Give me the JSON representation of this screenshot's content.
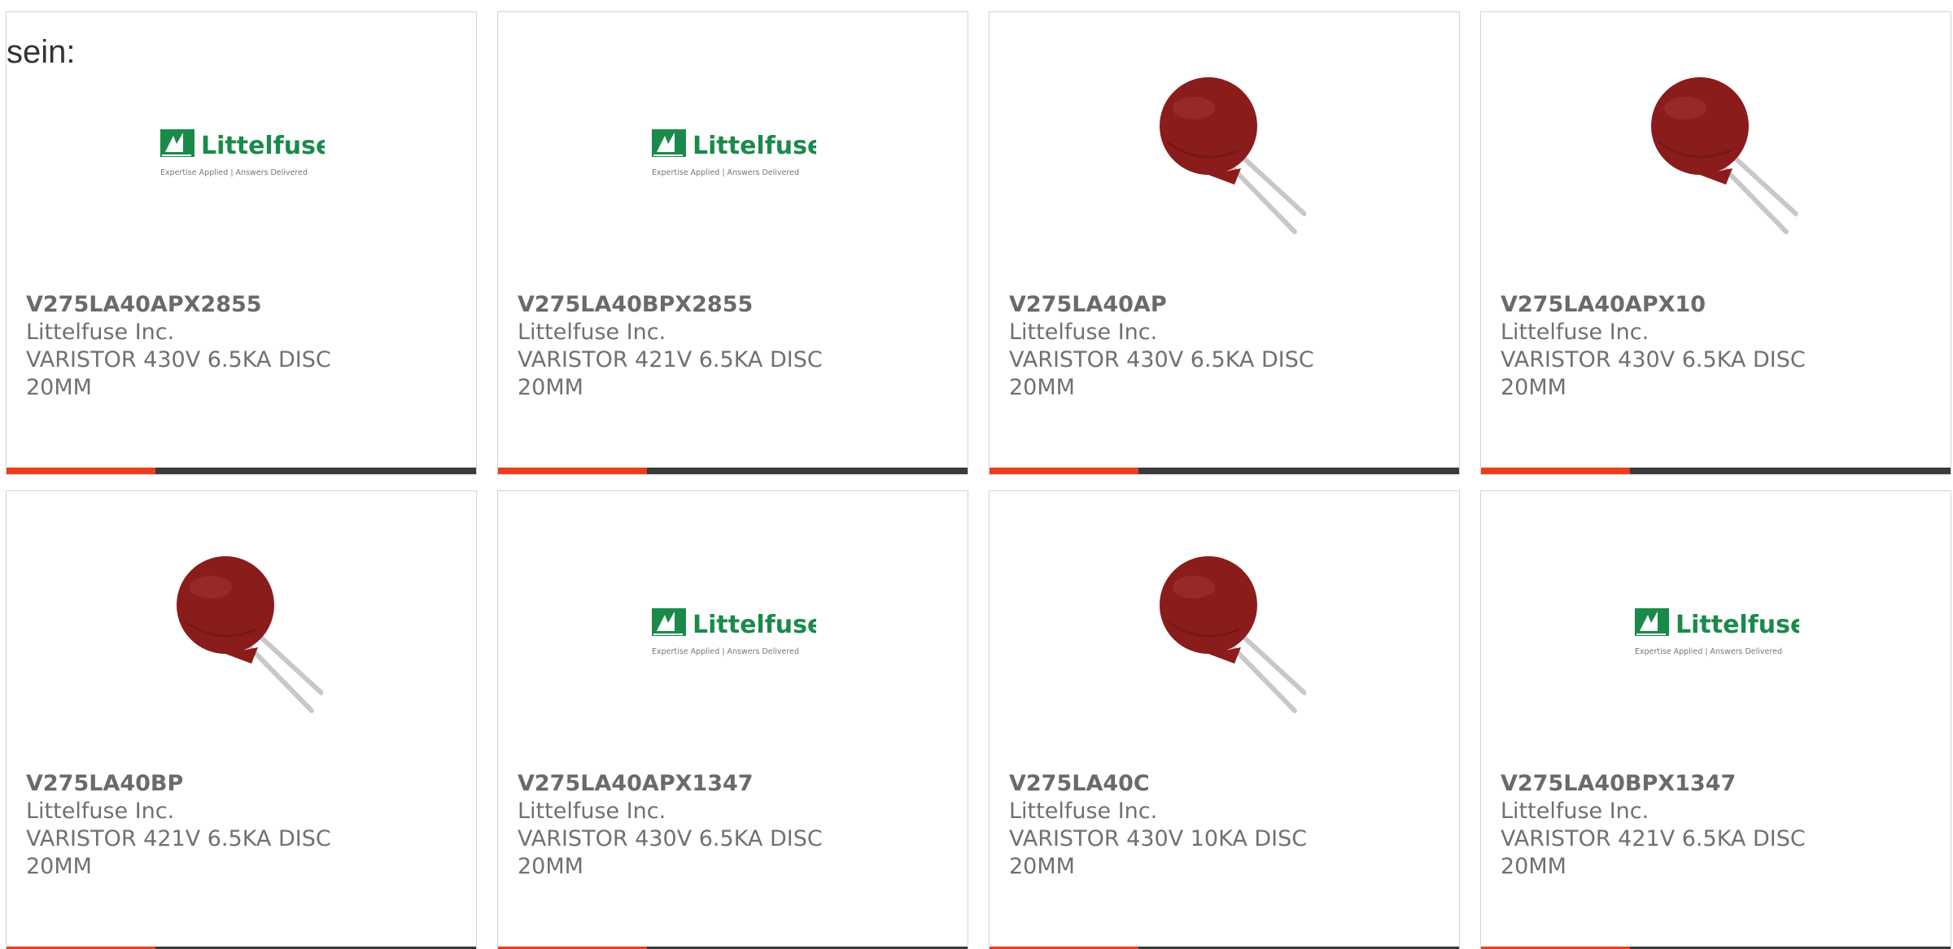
{
  "intro_text": "sein:",
  "brand": {
    "logo_name": "Littelfuse",
    "logo_tagline": "Expertise Applied | Answers Delivered",
    "logo_color": "#1a8a4a"
  },
  "colors": {
    "accent": "#e8401c",
    "bar": "#3a3a3a",
    "varistor_body": "#8b1c1c"
  },
  "products": [
    {
      "part_number": "V275LA40APX2855",
      "manufacturer": "Littelfuse Inc.",
      "description": "VARISTOR 430V 6.5KA DISC 20MM",
      "image": "littelfuse-logo"
    },
    {
      "part_number": "V275LA40BPX2855",
      "manufacturer": "Littelfuse Inc.",
      "description": "VARISTOR 421V 6.5KA DISC 20MM",
      "image": "littelfuse-logo"
    },
    {
      "part_number": "V275LA40AP",
      "manufacturer": "Littelfuse Inc.",
      "description": "VARISTOR 430V 6.5KA DISC 20MM",
      "image": "varistor-photo"
    },
    {
      "part_number": "V275LA40APX10",
      "manufacturer": "Littelfuse Inc.",
      "description": "VARISTOR 430V 6.5KA DISC 20MM",
      "image": "varistor-photo"
    },
    {
      "part_number": "V275LA40BP",
      "manufacturer": "Littelfuse Inc.",
      "description": "VARISTOR 421V 6.5KA DISC 20MM",
      "image": "varistor-photo"
    },
    {
      "part_number": "V275LA40APX1347",
      "manufacturer": "Littelfuse Inc.",
      "description": "VARISTOR 430V 6.5KA DISC 20MM",
      "image": "littelfuse-logo"
    },
    {
      "part_number": "V275LA40C",
      "manufacturer": "Littelfuse Inc.",
      "description": "VARISTOR 430V 10KA DISC 20MM",
      "image": "varistor-photo"
    },
    {
      "part_number": "V275LA40BPX1347",
      "manufacturer": "Littelfuse Inc.",
      "description": "VARISTOR 421V 6.5KA DISC 20MM",
      "image": "littelfuse-logo"
    }
  ]
}
